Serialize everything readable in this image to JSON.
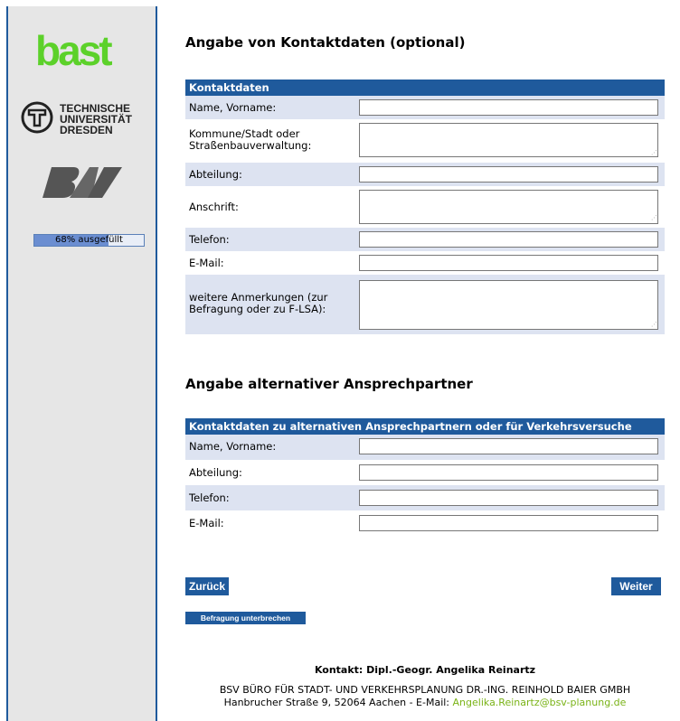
{
  "sidebar": {
    "logo_bast": "bast",
    "logo_tud_lines": [
      "TECHNISCHE",
      "UNIVERSITÄT",
      "DRESDEN"
    ],
    "logo_bsv": "BSV",
    "progress_label": "68% ausgefüllt",
    "progress_fraction": 0.68
  },
  "section1": {
    "heading": "Angabe von Kontaktdaten (optional)",
    "table_header": "Kontaktdaten",
    "fields": [
      {
        "label": "Name, Vorname:"
      },
      {
        "label": "Kommune/Stadt oder Straßenbauverwaltung:"
      },
      {
        "label": "Abteilung:"
      },
      {
        "label": "Anschrift:"
      },
      {
        "label": "Telefon:"
      },
      {
        "label": "E-Mail:"
      },
      {
        "label": "weitere Anmerkungen (zur Befragung oder zu F-LSA):"
      }
    ]
  },
  "section2": {
    "heading": "Angabe alternativer Ansprechpartner",
    "table_header": "Kontaktdaten zu alternativen Ansprechpartnern oder für Verkehrsversuche",
    "fields": [
      {
        "label": "Name, Vorname:"
      },
      {
        "label": "Abteilung:"
      },
      {
        "label": "Telefon:"
      },
      {
        "label": "E-Mail:"
      }
    ]
  },
  "buttons": {
    "back": "Zurück",
    "next": "Weiter",
    "pause": "Befragung unterbrechen"
  },
  "footer": {
    "contact_label": "Kontakt: Dipl.-Geogr. Angelika Reinartz",
    "company": "BSV BÜRO FÜR STADT- UND VERKEHRSPLANUNG DR.-ING. REINHOLD BAIER GMBH",
    "address": "Hanbrucher Straße 9, 52064 Aachen - E-Mail:",
    "email": "Angelika.Reinartz@bsv-planung.de"
  },
  "colors": {
    "accent": "#1f5a9c",
    "row_shade": "#dde3f1",
    "bast_green": "#5cd12a",
    "email_green": "#7ab317"
  }
}
